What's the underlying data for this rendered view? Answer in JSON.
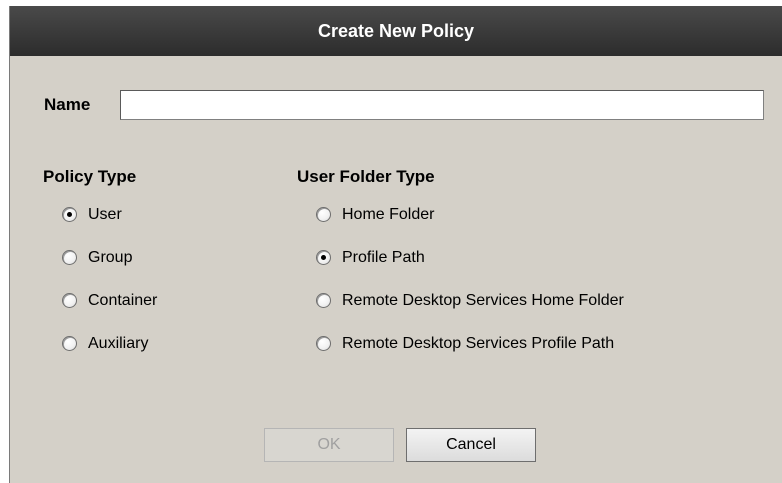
{
  "dialog": {
    "title": "Create New Policy"
  },
  "name_field": {
    "label": "Name",
    "value": ""
  },
  "policy_type": {
    "title": "Policy Type",
    "options": [
      {
        "label": "User",
        "checked": true
      },
      {
        "label": "Group",
        "checked": false
      },
      {
        "label": "Container",
        "checked": false
      },
      {
        "label": "Auxiliary",
        "checked": false
      }
    ]
  },
  "user_folder_type": {
    "title": "User Folder Type",
    "options": [
      {
        "label": "Home Folder",
        "checked": false
      },
      {
        "label": "Profile Path",
        "checked": true
      },
      {
        "label": "Remote Desktop Services Home Folder",
        "checked": false
      },
      {
        "label": "Remote Desktop Services Profile Path",
        "checked": false
      }
    ]
  },
  "buttons": {
    "ok_label": "OK",
    "ok_enabled": false,
    "cancel_label": "Cancel"
  }
}
